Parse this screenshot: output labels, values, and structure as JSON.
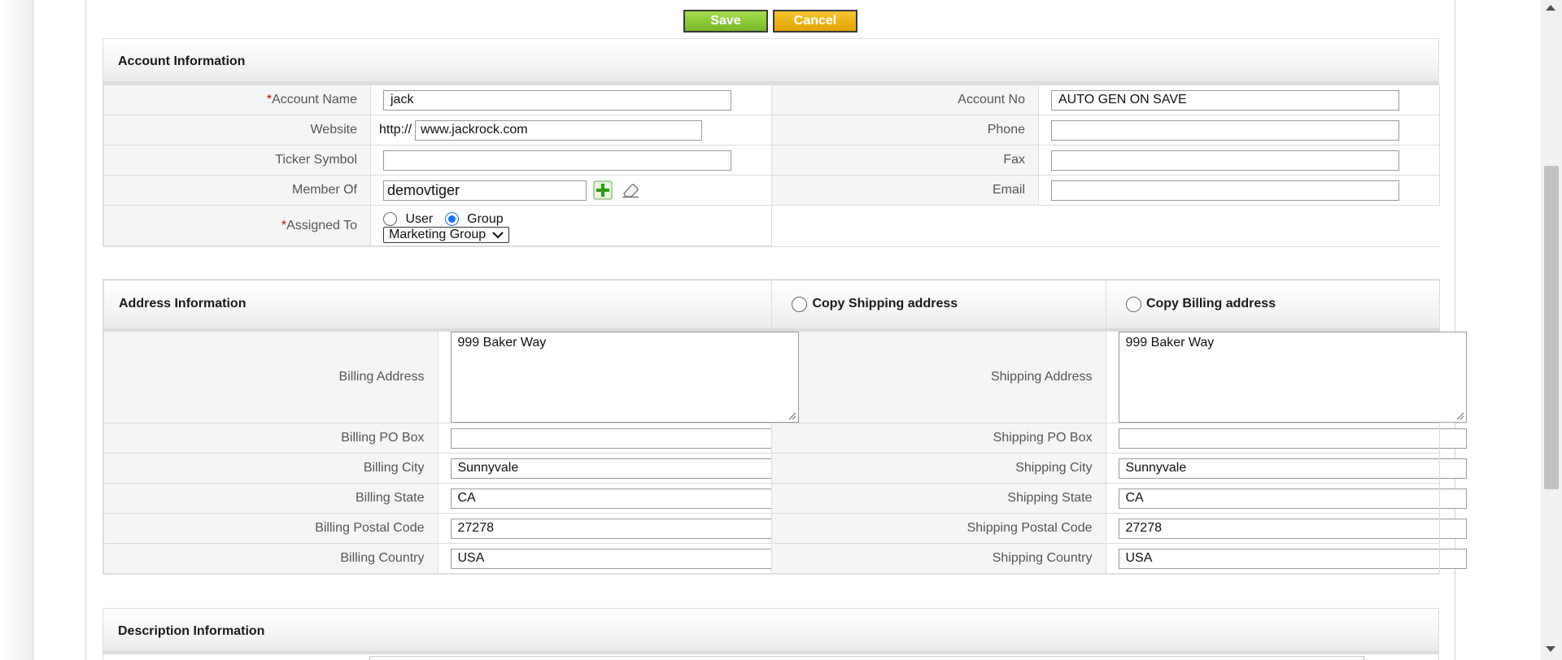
{
  "buttons": {
    "save": "Save",
    "cancel": "Cancel"
  },
  "account": {
    "title": "Account Information",
    "req_mark": "*",
    "account_name_label": "Account Name",
    "account_name_value": "jack",
    "account_no_label": "Account No",
    "account_no_value": "AUTO GEN ON SAVE",
    "website_label": "Website",
    "website_prefix": "http://",
    "website_value": "www.jackrock.com",
    "phone_label": "Phone",
    "phone_value": "",
    "ticker_label": "Ticker Symbol",
    "ticker_value": "",
    "fax_label": "Fax",
    "fax_value": "",
    "member_of_label": "Member Of",
    "member_of_value": "demovtiger",
    "email_label": "Email",
    "email_value": "",
    "assigned_to_label": "Assigned To",
    "assigned_user_label": "User",
    "assigned_group_label": "Group",
    "assigned_selected": "Group",
    "group_select_value": "Marketing Group"
  },
  "address": {
    "title": "Address Information",
    "copy_shipping_label": "Copy Shipping address",
    "copy_billing_label": "Copy Billing address",
    "billing_address_label": "Billing Address",
    "billing_address_value": "999 Baker Way",
    "shipping_address_label": "Shipping Address",
    "shipping_address_value": "999 Baker Way",
    "billing_po_label": "Billing PO Box",
    "billing_po_value": "",
    "shipping_po_label": "Shipping PO Box",
    "shipping_po_value": "",
    "billing_city_label": "Billing City",
    "billing_city_value": "Sunnyvale",
    "shipping_city_label": "Shipping City",
    "shipping_city_value": "Sunnyvale",
    "billing_state_label": "Billing State",
    "billing_state_value": "CA",
    "shipping_state_label": "Shipping State",
    "shipping_state_value": "CA",
    "billing_postal_label": "Billing Postal Code",
    "billing_postal_value": "27278",
    "shipping_postal_label": "Shipping Postal Code",
    "shipping_postal_value": "27278",
    "billing_country_label": "Billing Country",
    "billing_country_value": "USA",
    "shipping_country_label": "Shipping Country",
    "shipping_country_value": "USA"
  },
  "description": {
    "title": "Description Information"
  },
  "colors": {
    "save_green": "#8ccc3a",
    "cancel_orange": "#eeb60e",
    "required_red": "#cc0000"
  }
}
